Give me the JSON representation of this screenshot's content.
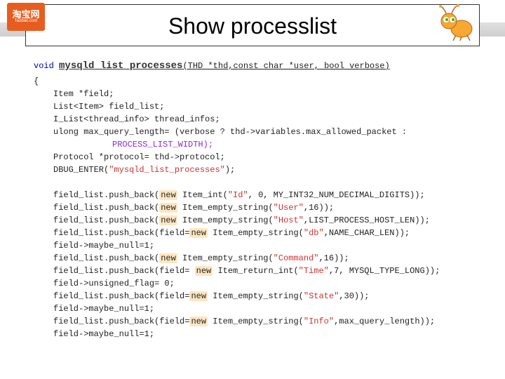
{
  "slide": {
    "title": "Show processlist",
    "logo": {
      "cn": "淘宝网",
      "en": "Taobao.com"
    },
    "icon_name": "taobao-ant-mascot"
  },
  "code": {
    "sig_prefix": "void ",
    "fn_name": "mysqld_list_processes",
    "sig_params": "(THD *thd,const char *user, bool verbose)",
    "brace_open": "{",
    "decl1": "Item *field;",
    "decl2": "List<Item> field_list;",
    "decl3": "I_List<thread_info> thread_infos;",
    "decl4a": "ulong max_query_length= (verbose ? thd->variables.max_allowed_packet :",
    "decl4b": "PROCESS_LIST_WIDTH);",
    "decl5": "Protocol *protocol= thd->protocol;",
    "decl6_pre": "DBUG_ENTER(",
    "decl6_str": "\"mysqld_list_processes\"",
    "decl6_post": ");",
    "blank": " ",
    "l1_pre": "field_list.push_back(",
    "l1_new": "new",
    "l1_mid": " Item_int(",
    "l1_str": "\"Id\"",
    "l1_post": ", 0, MY_INT32_NUM_DECIMAL_DIGITS));",
    "l2_pre": "field_list.push_back(",
    "l2_new": "new",
    "l2_mid": " Item_empty_string(",
    "l2_str": "\"User\"",
    "l2_post": ",16));",
    "l3_pre": "field_list.push_back(",
    "l3_new": "new",
    "l3_mid": " Item_empty_string(",
    "l3_str": "\"Host\"",
    "l3_post": ",LIST_PROCESS_HOST_LEN));",
    "l4_pre": "field_list.push_back(field=",
    "l4_new": "new",
    "l4_mid": " Item_empty_string(",
    "l4_str": "\"db\"",
    "l4_post": ",NAME_CHAR_LEN));",
    "l5": "field->maybe_null=1;",
    "l6_pre": "field_list.push_back(",
    "l6_new": "new",
    "l6_mid": " Item_empty_string(",
    "l6_str": "\"Command\"",
    "l6_post": ",16));",
    "l7_pre": "field_list.push_back(field= ",
    "l7_new": "new",
    "l7_mid": " Item_return_int(",
    "l7_str": "\"Time\"",
    "l7_post": ",7, MYSQL_TYPE_LONG));",
    "l8": "field->unsigned_flag= 0;",
    "l9_pre": "field_list.push_back(field=",
    "l9_new": "new",
    "l9_mid": " Item_empty_string(",
    "l9_str": "\"State\"",
    "l9_post": ",30));",
    "l10": "field->maybe_null=1;",
    "l11_pre": "field_list.push_back(field=",
    "l11_new": "new",
    "l11_mid": " Item_empty_string(",
    "l11_str": "\"Info\"",
    "l11_post": ",max_query_length));",
    "l12": "field->maybe_null=1;"
  }
}
